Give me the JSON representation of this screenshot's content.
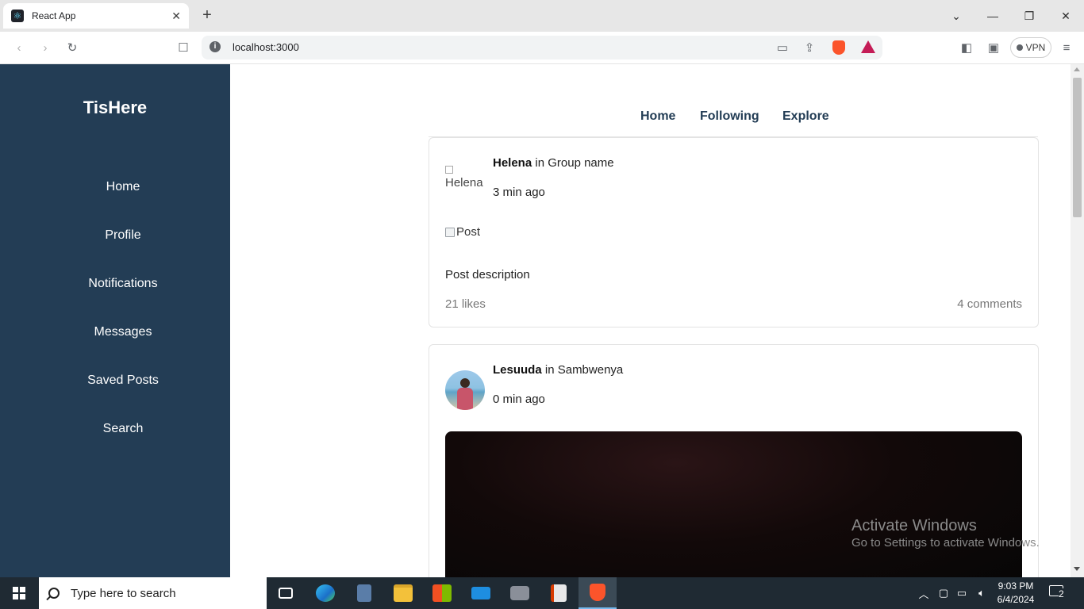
{
  "browser": {
    "tab_title": "React App",
    "tab_close": "✕",
    "new_tab": "+",
    "url": "localhost:3000",
    "vpn_label": "VPN",
    "window_controls": [
      "chevron-down",
      "minimize",
      "restore",
      "close"
    ]
  },
  "sidebar": {
    "logo": "TisHere",
    "items": [
      {
        "label": "Home"
      },
      {
        "label": "Profile"
      },
      {
        "label": "Notifications"
      },
      {
        "label": "Messages"
      },
      {
        "label": "Saved Posts"
      },
      {
        "label": "Search"
      }
    ]
  },
  "topnav": {
    "links": [
      {
        "label": "Home"
      },
      {
        "label": "Following"
      },
      {
        "label": "Explore"
      }
    ]
  },
  "posts": [
    {
      "author": "Helena",
      "in_word": "in",
      "group": "Group name",
      "time": "3 min ago",
      "avatar_alt": "Helena",
      "image_alt": "Post",
      "description": "Post description",
      "likes": "21 likes",
      "comments": "4 comments"
    },
    {
      "author": "Lesuuda",
      "in_word": "in",
      "group": "Sambwenya",
      "time": "0 min ago"
    }
  ],
  "watermark": {
    "title": "Activate Windows",
    "subtitle": "Go to Settings to activate Windows."
  },
  "taskbar": {
    "search_placeholder": "Type here to search",
    "time": "9:03 PM",
    "date": "6/4/2024",
    "notification_count": "2",
    "apps": [
      "task-view",
      "edge",
      "calculator",
      "file-explorer",
      "microsoft-store",
      "mail",
      "camera",
      "office-app",
      "brave"
    ]
  },
  "colors": {
    "sidebar_bg": "#233d55",
    "accent_text": "#233d55",
    "taskbar_bg": "#1f2a33"
  }
}
